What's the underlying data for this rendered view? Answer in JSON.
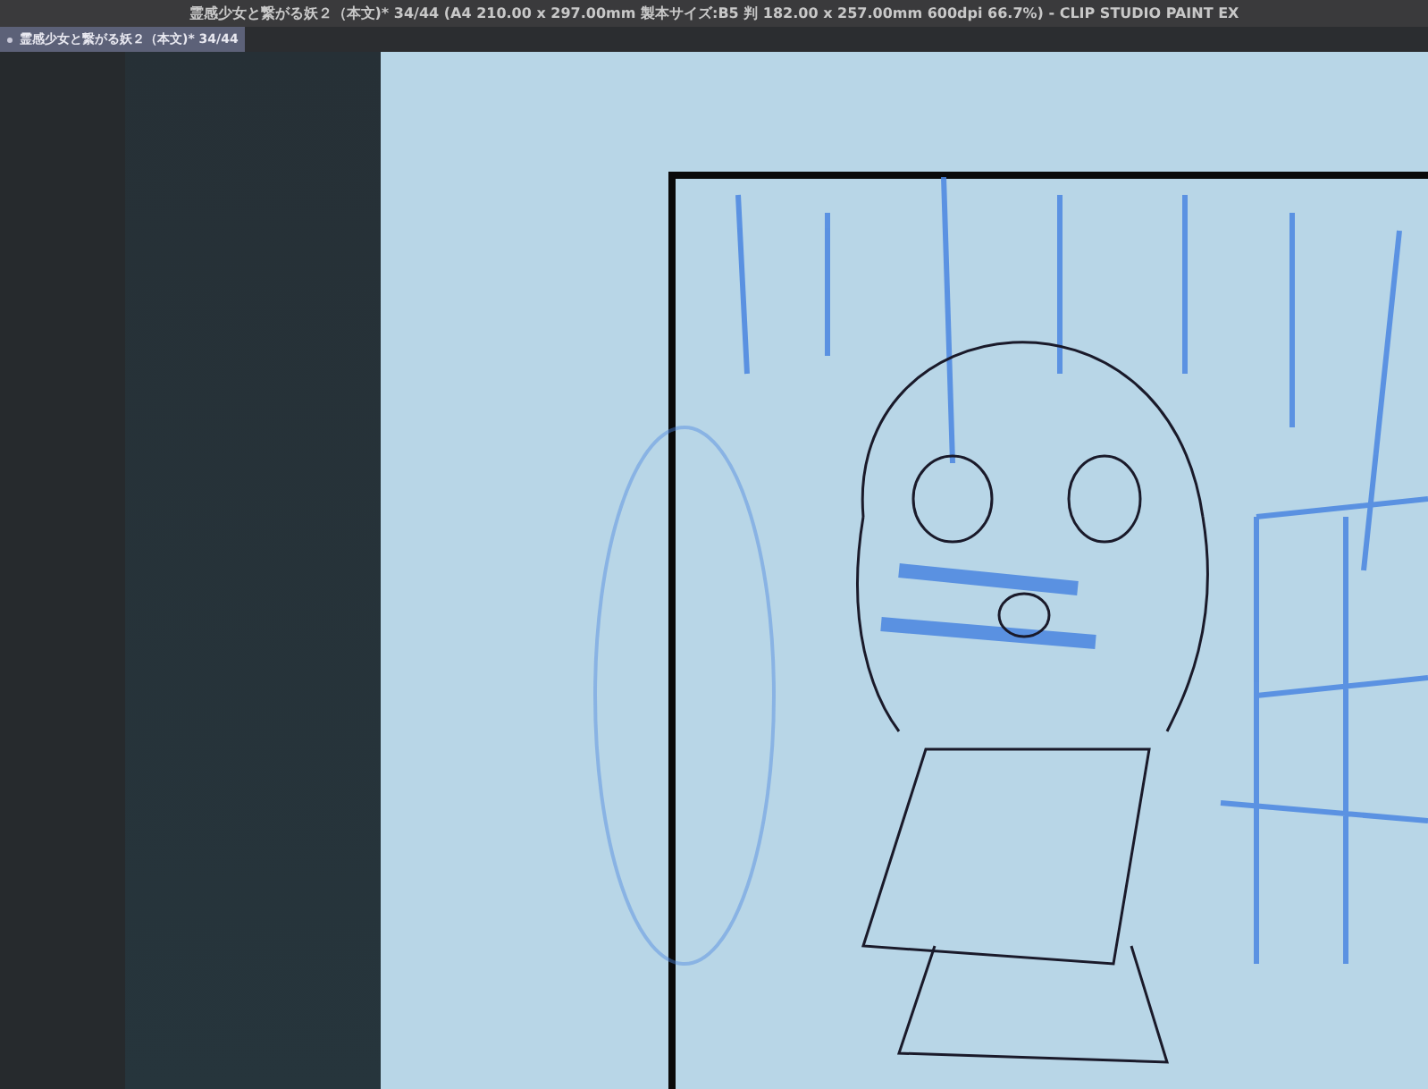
{
  "window": {
    "title": "霊感少女と繋がる妖２（本文)* 34/44 (A4 210.00 x 297.00mm 製本サイズ:B5 判 182.00 x 257.00mm 600dpi 66.7%)  - CLIP STUDIO PAINT EX"
  },
  "tabs": [
    {
      "label": "霊感少女と繋がる妖２（本文)* 34/44",
      "selected": true
    }
  ]
}
